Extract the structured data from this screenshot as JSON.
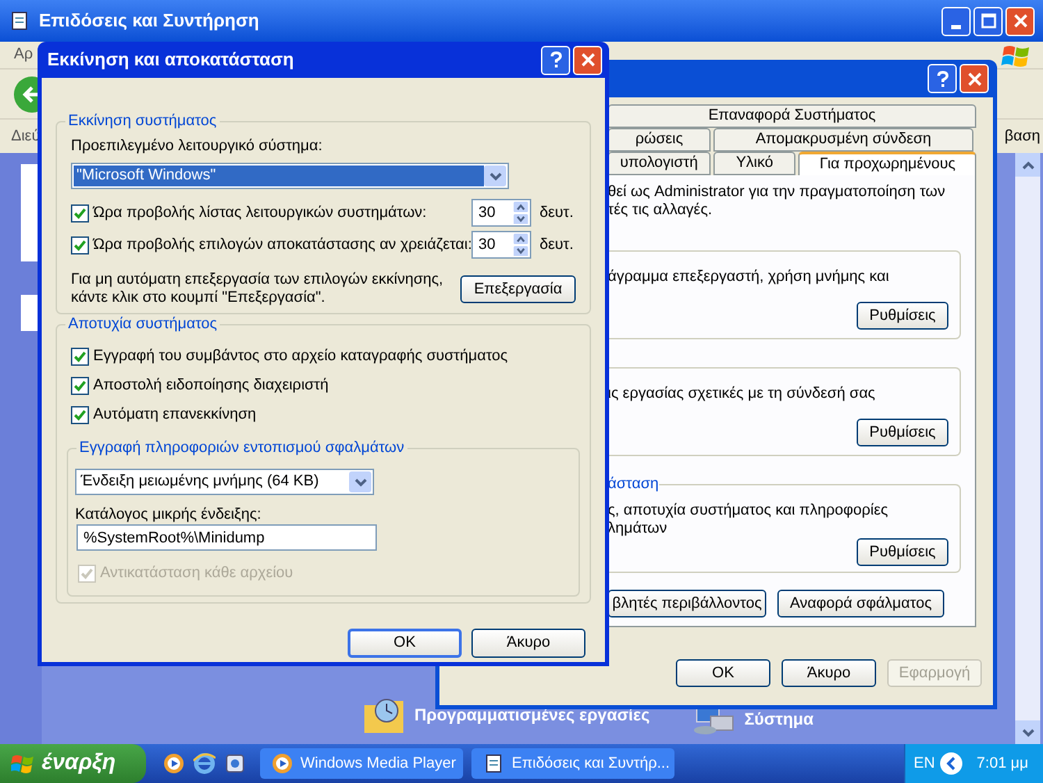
{
  "background_window": {
    "title": "Επιδόσεις και Συντήρηση",
    "menu_fragment": "Αρ",
    "address_label": "Διεύ",
    "address_fragment": "βαση",
    "tasks": [
      {
        "label": "Προγραμματισμένες εργασίες",
        "kind": "folder"
      },
      {
        "label": "Σύστημα",
        "kind": "system"
      }
    ]
  },
  "system_properties": {
    "tab_rows": [
      [
        {
          "label": "Επαναφορά Συστήματος",
          "selected": false
        }
      ],
      [
        {
          "label": "ρώσεις",
          "selected": false
        },
        {
          "label": "Απομακρυσμένη σύνδεση",
          "selected": false
        }
      ],
      [
        {
          "label": "υπολογιστή",
          "selected": false
        },
        {
          "label": "Υλικό",
          "selected": false
        },
        {
          "label": "Για προχωρημένους",
          "selected": true
        }
      ]
    ],
    "intro": [
      "θεί ως Administrator για την πραγματοποίηση των",
      "τές τις αλλαγές."
    ],
    "groups": [
      {
        "text": [
          "άγραμμα επεξεργαστή, χρήση μνήμης και"
        ],
        "button": "Ρυθμίσεις"
      },
      {
        "text": [
          "ις εργασίας σχετικές με τη σύνδεσή σας"
        ],
        "button": "Ρυθμίσεις"
      },
      {
        "legend": "άσταση",
        "text": [
          "ς, αποτυχία συστήματος και πληροφορίες",
          "λημάτων"
        ],
        "button": "Ρυθμίσεις"
      }
    ],
    "extra_buttons": [
      "βλητές περιβάλλοντος",
      "Αναφορά σφάλματος"
    ],
    "footer_buttons": [
      {
        "label": "OK",
        "disabled": false
      },
      {
        "label": "Άκυρο",
        "disabled": false
      },
      {
        "label": "Εφαρμογή",
        "disabled": true
      }
    ]
  },
  "startup_dialog": {
    "title": "Εκκίνηση και αποκατάσταση",
    "startup": {
      "legend": "Εκκίνηση συστήματος",
      "os_label": "Προεπιλεγμένο λειτουργικό σύστημα:",
      "os_select": {
        "value": "\"Microsoft Windows\"",
        "focused": true
      },
      "timeouts": [
        {
          "label": "Ώρα προβολής λίστας λειτουργικών συστημάτων:",
          "checked": true,
          "value": "30",
          "unit": "δευτ."
        },
        {
          "label": "Ώρα προβολής επιλογών αποκατάστασης αν χρειάζεται:",
          "checked": true,
          "value": "30",
          "unit": "δευτ."
        }
      ],
      "edit_text": "Για μη αυτόματη επεξεργασία των επιλογών εκκίνησης, κάντε κλικ στο κουμπί \"Επεξεργασία\".",
      "edit_button": "Επεξεργασία"
    },
    "failure": {
      "legend": "Αποτυχία συστήματος",
      "options": [
        {
          "label": "Εγγραφή του συμβάντος στο αρχείο καταγραφής συστήματος",
          "checked": true
        },
        {
          "label": "Αποστολή ειδοποίησης διαχειριστή",
          "checked": true
        },
        {
          "label": "Αυτόματη επανεκκίνηση",
          "checked": true
        }
      ],
      "debug": {
        "legend": "Εγγραφή πληροφοριών εντοπισμού σφαλμάτων",
        "select": {
          "value": "Ένδειξη μειωμένης μνήμης (64 KB)",
          "focused": false
        },
        "dir_label": "Κατάλογος μικρής ένδειξης:",
        "dir_value": "%SystemRoot%\\Minidump",
        "overwrite": {
          "label": "Αντικατάσταση κάθε αρχείου",
          "checked": true,
          "disabled": true
        }
      }
    },
    "buttons": [
      "OK",
      "Άκυρο"
    ]
  },
  "taskbar": {
    "start": "έναρξη",
    "tasks": [
      {
        "label": "Windows Media Player",
        "kind": "media"
      },
      {
        "label": "Επιδόσεις και Συντήρ...",
        "kind": "control"
      }
    ],
    "language": "EN",
    "clock": "7:01 μμ"
  }
}
